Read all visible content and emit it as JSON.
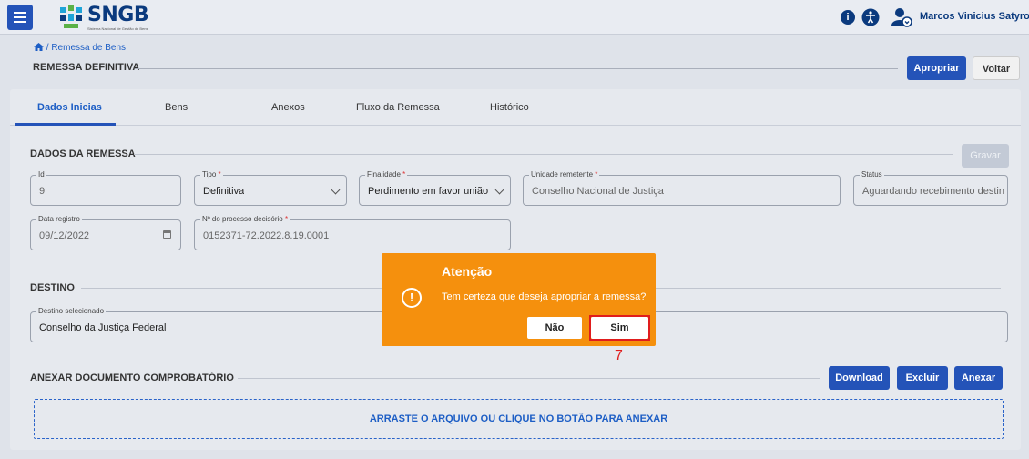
{
  "header": {
    "logo_text": "SNGB",
    "logo_subtitle": "Sistema Nacional de Gestão de Bens",
    "user_name": "Marcos Vinicius Satyro C..."
  },
  "page": {
    "breadcrumb": "/ Remessa de Bens",
    "title": "REMESSA DEFINITIVA",
    "apropriar_label": "Apropriar",
    "voltar_label": "Voltar"
  },
  "tabs": [
    "Dados Inicias",
    "Bens",
    "Anexos",
    "Fluxo da Remessa",
    "Histórico"
  ],
  "dados_remessa": {
    "title": "DADOS DA REMESSA",
    "gravar_label": "Gravar",
    "fields": {
      "id": {
        "label": "Id",
        "value": "9"
      },
      "tipo": {
        "label": "Tipo",
        "value": "Definitiva"
      },
      "finalidade": {
        "label": "Finalidade",
        "value": "Perdimento em favor união"
      },
      "unidade": {
        "label": "Unidade remetente",
        "value": "Conselho Nacional de Justiça"
      },
      "status": {
        "label": "Status",
        "value": "Aguardando recebimento destin"
      },
      "data_registro": {
        "label": "Data registro",
        "value": "09/12/2022"
      },
      "processo": {
        "label": "Nº do processo decisório",
        "value": "0152371-72.2022.8.19.0001"
      }
    }
  },
  "destino": {
    "title": "DESTINO",
    "label": "Destino selecionado",
    "value": "Conselho da Justiça Federal"
  },
  "anexar": {
    "title": "ANEXAR DOCUMENTO COMPROBATÓRIO",
    "download_label": "Download",
    "excluir_label": "Excluir",
    "anexar_label": "Anexar",
    "dropzone_text": "ARRASTE O ARQUIVO OU CLIQUE NO BOTÃO PARA ANEXAR"
  },
  "dialog": {
    "title": "Atenção",
    "message": "Tem certeza que deseja apropriar a remessa?",
    "no_label": "Não",
    "yes_label": "Sim"
  },
  "annotation": {
    "step_number": "7",
    "color": "#e01d1d"
  },
  "colors": {
    "primary": "#2453b8",
    "dialog": "#f5900d",
    "link": "#1d5ec5"
  }
}
